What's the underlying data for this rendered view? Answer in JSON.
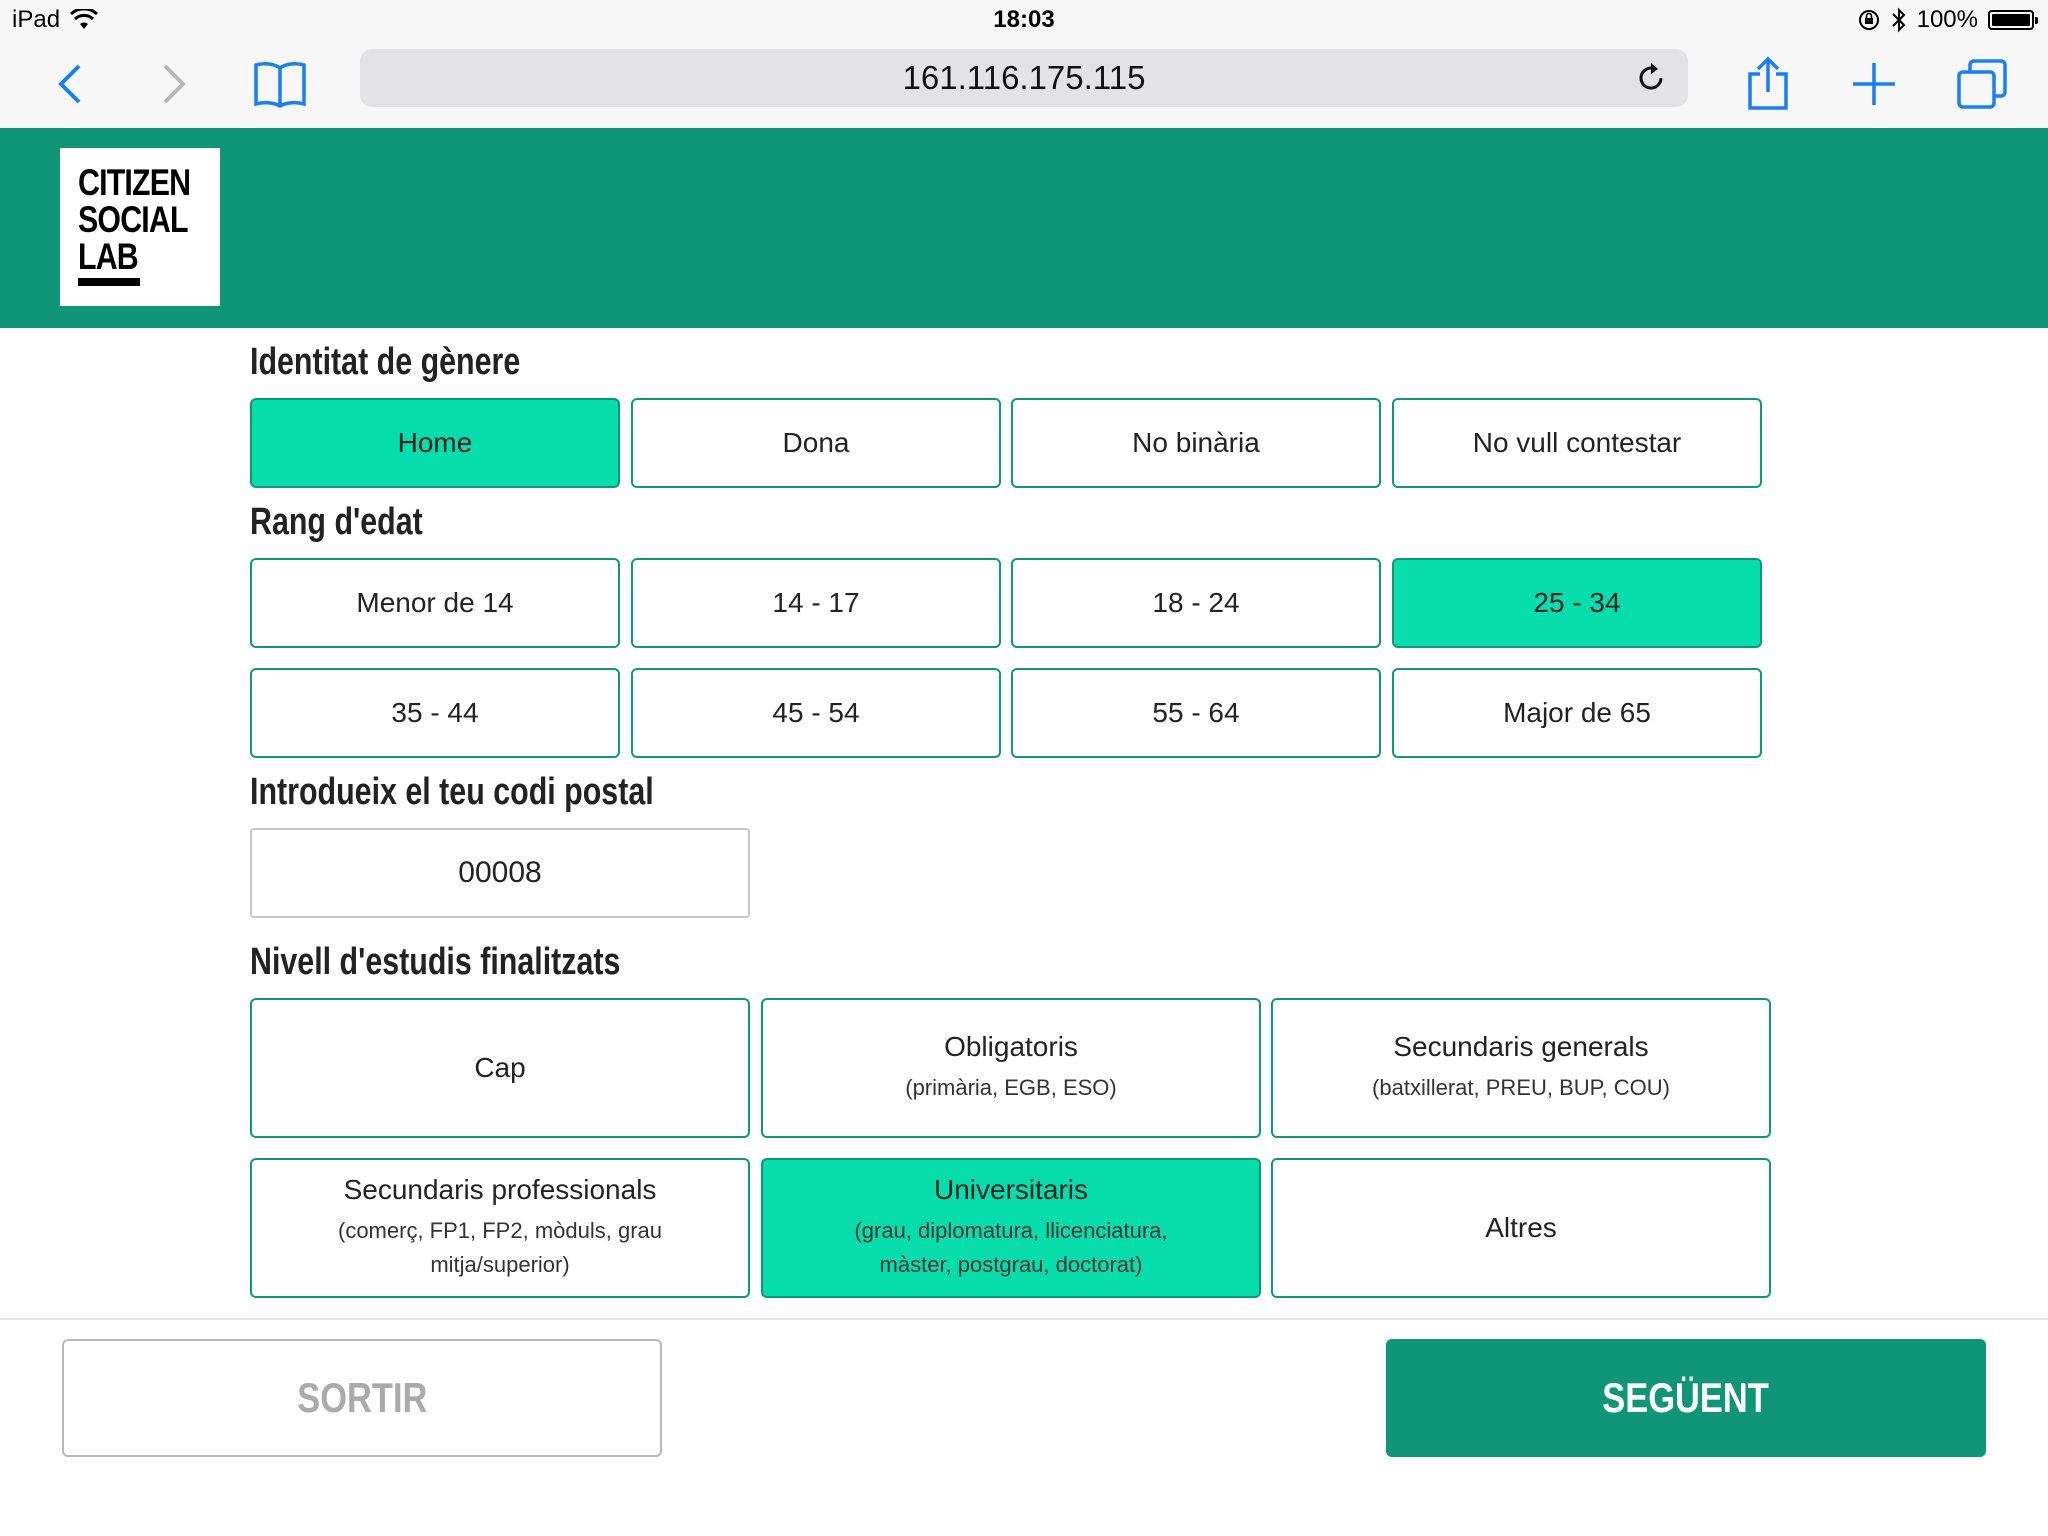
{
  "status_bar": {
    "device": "iPad",
    "time": "18:03",
    "battery": "100%",
    "battery_level": 1.0
  },
  "browser": {
    "url": "161.116.175.115"
  },
  "app": {
    "logo_lines": [
      "CITIZEN",
      "SOCIAL",
      "LAB"
    ],
    "brand_color": "#109676",
    "selected_color": "#06dcac"
  },
  "gender": {
    "title": "Identitat de gènere",
    "options": [
      "Home",
      "Dona",
      "No binària",
      "No vull contestar"
    ],
    "selected": "Home"
  },
  "age": {
    "title": "Rang d'edat",
    "options": [
      "Menor de 14",
      "14 - 17",
      "18 - 24",
      "25 - 34",
      "35 - 44",
      "45 - 54",
      "55 - 64",
      "Major de 65"
    ],
    "selected": "25 - 34"
  },
  "postal": {
    "title": "Introdueix el teu codi postal",
    "value": "00008"
  },
  "studies": {
    "title": "Nivell d'estudis finalitzats",
    "options": [
      {
        "label": "Cap",
        "detail": ""
      },
      {
        "label": "Obligatoris",
        "detail": "(primària, EGB, ESO)"
      },
      {
        "label": "Secundaris generals",
        "detail": "(batxillerat, PREU, BUP, COU)"
      },
      {
        "label": "Secundaris professionals",
        "detail": "(comerç, FP1, FP2, mòduls, grau mitja/superior)"
      },
      {
        "label": "Universitaris",
        "detail": "(grau, diplomatura, llicenciatura, màster, postgrau, doctorat)"
      },
      {
        "label": "Altres",
        "detail": ""
      }
    ],
    "selected": "Universitaris"
  },
  "footer": {
    "exit_label": "SORTIR",
    "next_label": "SEGÜENT"
  }
}
